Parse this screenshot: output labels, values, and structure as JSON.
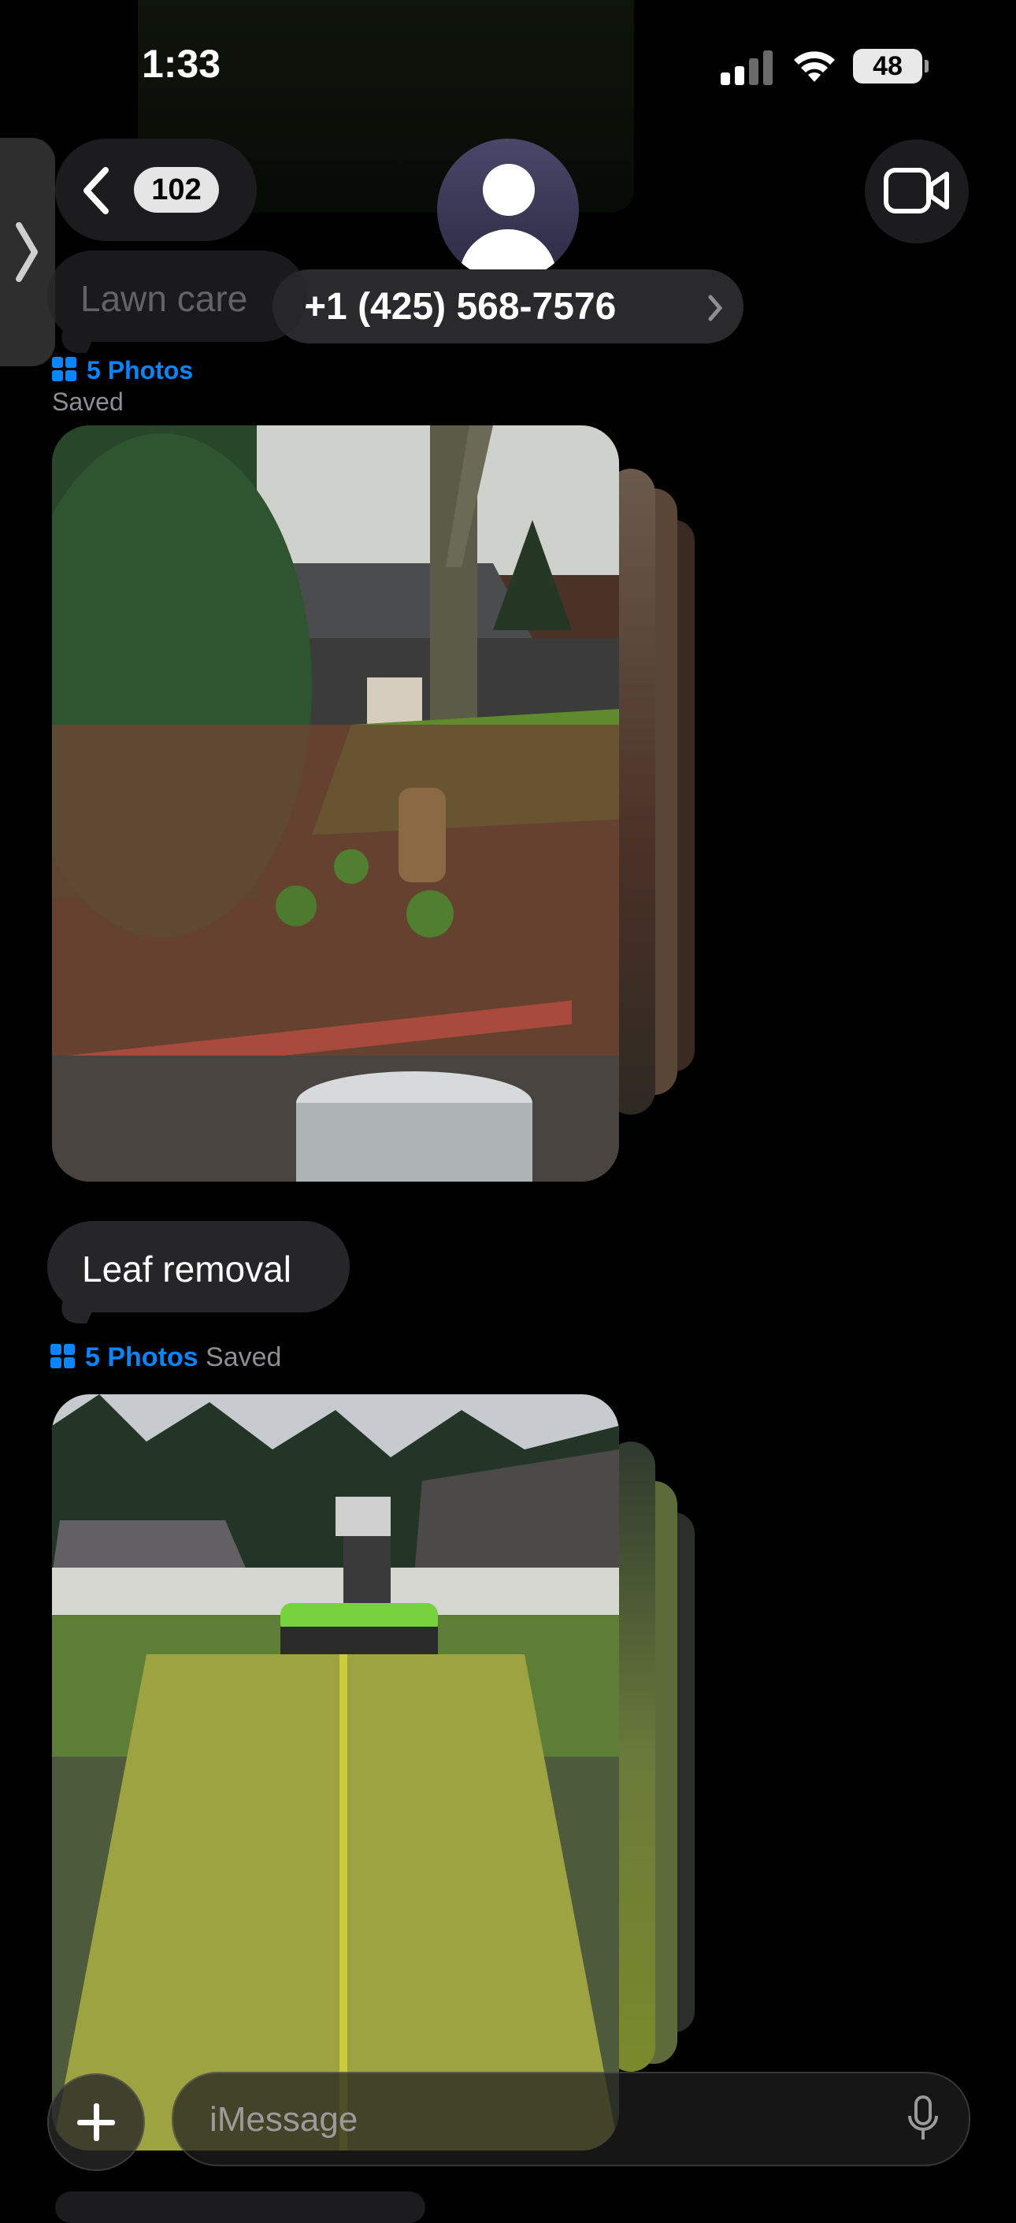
{
  "status_bar": {
    "time": "1:33",
    "battery": "48"
  },
  "header": {
    "back_count": "102",
    "contact": "+1 (425) 568-7576",
    "contact_chevron": "›"
  },
  "messages": [
    {
      "text": "Lawn care",
      "faded": true
    },
    {
      "photos_label": "5 Photos",
      "saved_label": "Saved"
    },
    {
      "text": "Leaf removal"
    },
    {
      "photos_label": "5 Photos",
      "saved_label": "Saved"
    }
  ],
  "composer": {
    "placeholder": "iMessage"
  },
  "icons": [
    "drawer-chevron-icon",
    "back-chevron-icon",
    "avatar-icon",
    "video-camera-icon",
    "photo-grid-icon",
    "plus-icon",
    "microphone-icon"
  ],
  "colors": {
    "accent": "#0a84ff",
    "bubble": "#262628",
    "background": "#000000"
  }
}
